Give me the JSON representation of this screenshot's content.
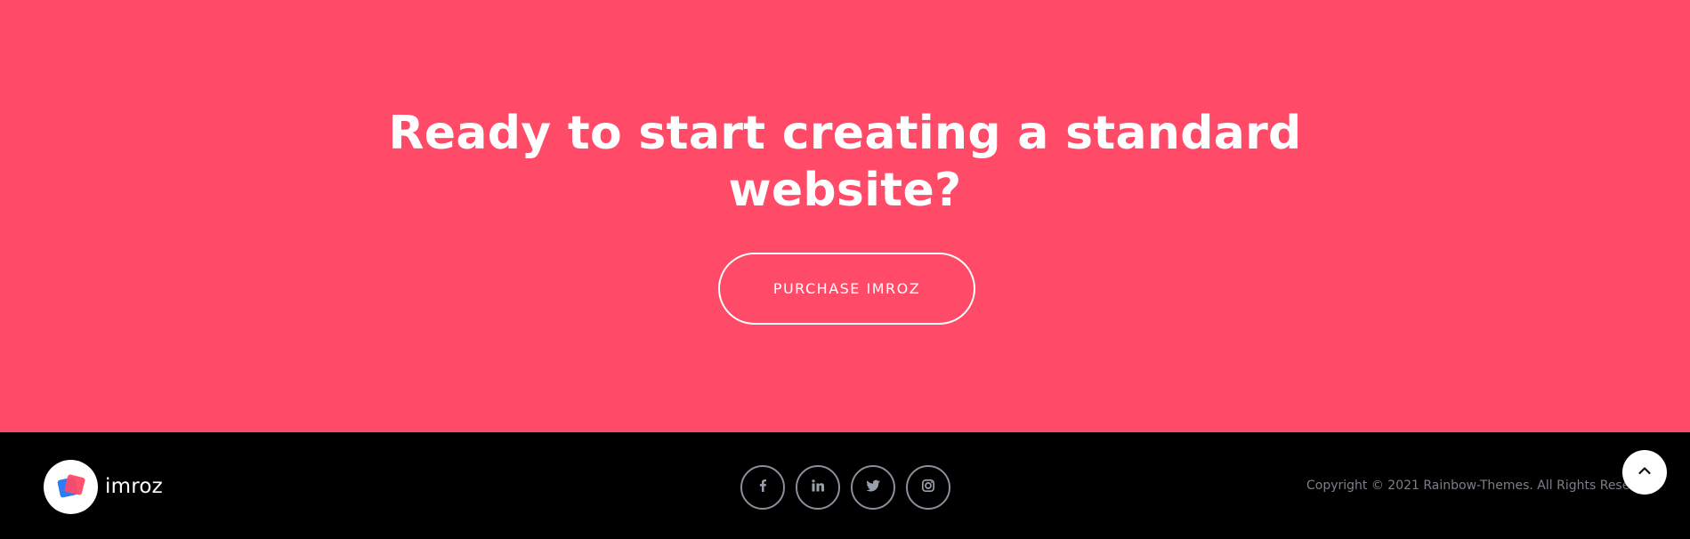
{
  "cta": {
    "title_line1": "Ready to start creating a standard",
    "title_line2": "website?",
    "button_label": "PURCHASE IMROZ",
    "background": "#ff4a68"
  },
  "footer": {
    "brand": "imroz",
    "socials": [
      {
        "name": "facebook",
        "icon": "facebook-icon"
      },
      {
        "name": "linkedin",
        "icon": "linkedin-icon"
      },
      {
        "name": "twitter",
        "icon": "twitter-icon"
      },
      {
        "name": "instagram",
        "icon": "instagram-icon"
      }
    ],
    "copyright": "Copyright © 2021 Rainbow-Themes. All Rights Reserved.",
    "background": "#000000"
  },
  "scroll_top": {
    "icon": "chevron-up-icon"
  }
}
